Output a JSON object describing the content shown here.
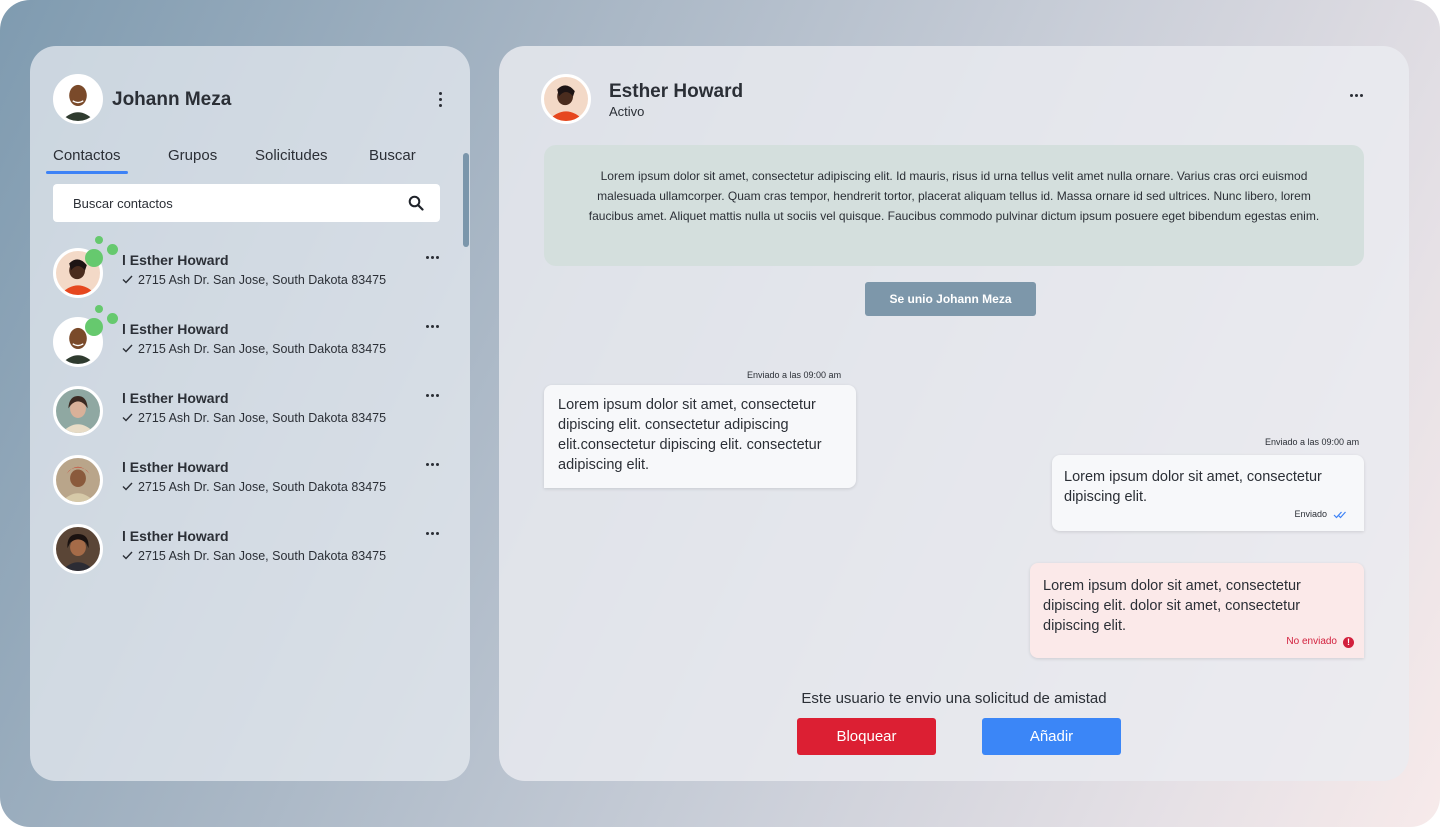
{
  "colors": {
    "accent": "#3d82f6",
    "online": "#66c96e",
    "notice_bg": "#d4dfdd",
    "joined_bg": "#7d97aa",
    "error": "#d21f3c",
    "block": "#dc1f33",
    "add": "#3b86f7"
  },
  "user": {
    "name": "Johann Meza"
  },
  "tabs": [
    {
      "label": "Contactos",
      "active": true
    },
    {
      "label": "Grupos",
      "active": false
    },
    {
      "label": "Solicitudes",
      "active": false
    },
    {
      "label": "Buscar",
      "active": false
    }
  ],
  "search": {
    "placeholder": "Buscar contactos",
    "icon": "search-icon"
  },
  "contacts": [
    {
      "name": "l Esther Howard",
      "address": "2715 Ash Dr. San Jose, South Dakota 83475",
      "online": true
    },
    {
      "name": "l Esther Howard",
      "address": "2715 Ash Dr. San Jose, South Dakota 83475",
      "online": true
    },
    {
      "name": "l Esther Howard",
      "address": "2715 Ash Dr. San Jose, South Dakota 83475",
      "online": false
    },
    {
      "name": "l Esther Howard",
      "address": "2715 Ash Dr. San Jose, South Dakota 83475",
      "online": false
    },
    {
      "name": "l Esther Howard",
      "address": "2715 Ash Dr. San Jose, South Dakota 83475",
      "online": false
    }
  ],
  "chat": {
    "name": "Esther Howard",
    "status": "Activo",
    "notice": "Lorem ipsum dolor sit amet, consectetur adipiscing elit. Id mauris, risus id urna tellus velit amet nulla ornare. Varius cras orci euismod malesuada ullamcorper. Quam cras tempor, hendrerit tortor, placerat aliquam tellus id. Massa ornare id sed ultrices. Nunc libero, lorem faucibus amet. Aliquet mattis nulla ut sociis vel quisque. Faucibus commodo pulvinar dictum ipsum posuere eget bibendum egestas enim.",
    "joined": "Se unio Johann Meza",
    "messages": [
      {
        "time": "Enviado a las 09:00 am",
        "text": "Lorem ipsum dolor sit amet, consectetur dipiscing elit. consectetur adipiscing elit.consectetur dipiscing elit. consectetur adipiscing elit.",
        "direction": "incoming"
      },
      {
        "time": "Enviado a las 09:00 am",
        "text": "Lorem ipsum dolor sit amet, consectetur dipiscing elit.",
        "direction": "outgoing",
        "status": "Enviado"
      },
      {
        "text": "Lorem ipsum dolor sit amet, consectetur dipiscing elit. dolor sit amet, consectetur dipiscing elit.",
        "direction": "outgoing",
        "status": "No enviado"
      }
    ],
    "request_text": "Este usuario te envio una solicitud de amistad",
    "block_label": "Bloquear",
    "add_label": "Añadir"
  }
}
